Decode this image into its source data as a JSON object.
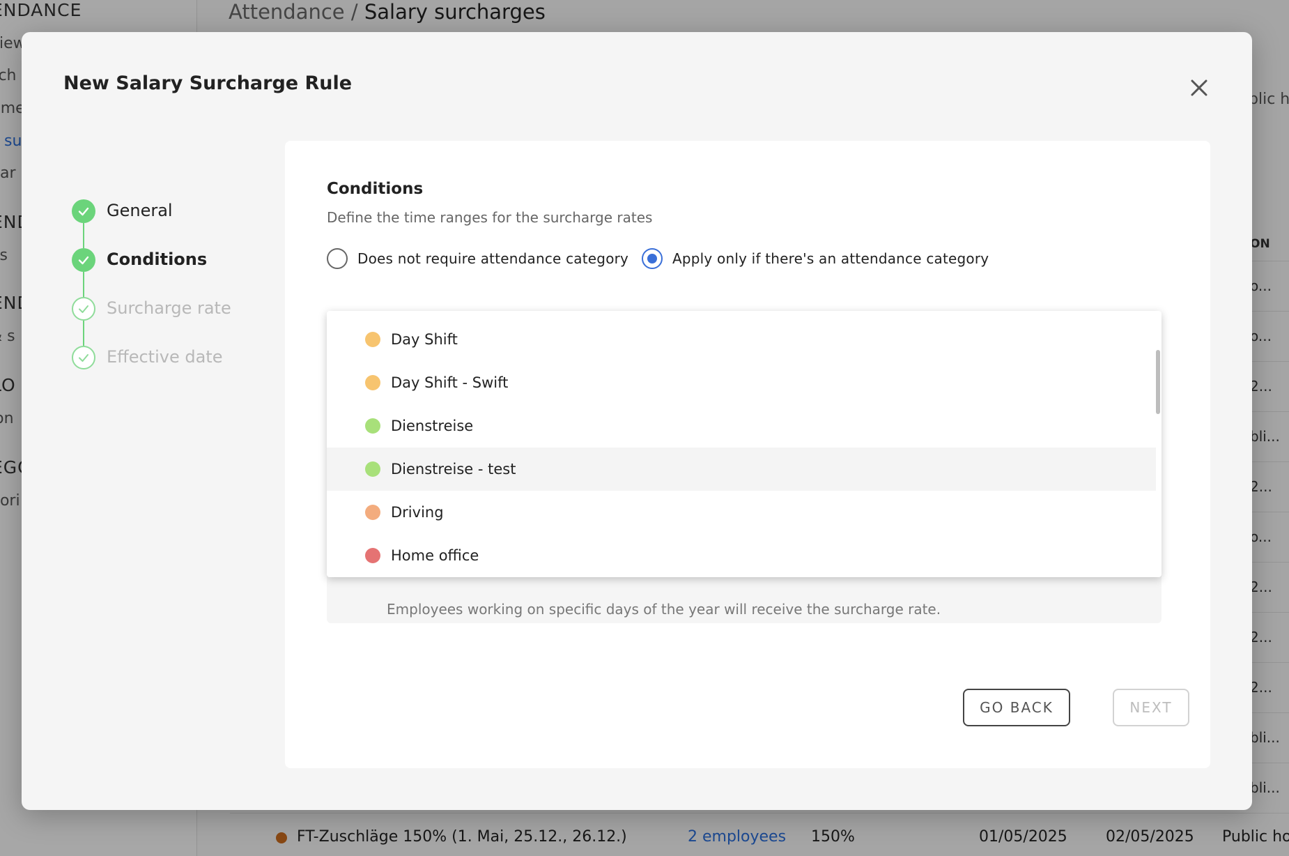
{
  "background": {
    "breadcrumb_parent": "Attendance /",
    "breadcrumb_current": "Salary surcharges",
    "sidebar_fragments": [
      {
        "text": "ENDANCE",
        "kind": "section"
      },
      {
        "text": "view",
        "kind": "item"
      },
      {
        "text": "sch",
        "kind": "item"
      },
      {
        "text": "time",
        "kind": "item"
      },
      {
        "text": "y su",
        "kind": "item",
        "active": true
      },
      {
        "text": "dar",
        "kind": "item"
      },
      {
        "text": "END",
        "kind": "section"
      },
      {
        "text": "es",
        "kind": "item"
      },
      {
        "text": "END",
        "kind": "section"
      },
      {
        "text": "& s",
        "kind": "item"
      },
      {
        "text": "LO",
        "kind": "section"
      },
      {
        "text": "ion",
        "kind": "item"
      },
      {
        "text": "EGO",
        "kind": "section"
      },
      {
        "text": "gori",
        "kind": "item"
      }
    ],
    "top_right_fragment": "blic ho",
    "column_header_fragment": "ON",
    "right_column_fragments": [
      "o...",
      "o...",
      "2...",
      "bli...",
      "2...",
      "o...",
      "2...",
      "2...",
      "2...",
      "bli...",
      "bli..."
    ],
    "last_row": {
      "name": "FT-Zuschläge 150% (1. Mai, 25.12., 26.12.)",
      "employees": "2 employees",
      "rate": "150%",
      "start": "01/05/2025",
      "end": "02/05/2025",
      "type": "Public holi..."
    }
  },
  "modal": {
    "title": "New Salary Surcharge Rule",
    "steps": [
      {
        "label": "General",
        "state": "done"
      },
      {
        "label": "Conditions",
        "state": "current"
      },
      {
        "label": "Surcharge rate",
        "state": "todo"
      },
      {
        "label": "Effective date",
        "state": "todo"
      }
    ],
    "section_title": "Conditions",
    "section_subtitle": "Define the time ranges for the surcharge rates",
    "radio_options": [
      {
        "label": "Does not require attendance category",
        "selected": false
      },
      {
        "label": "Apply only if there's an attendance category",
        "selected": true
      }
    ],
    "dropdown_options": [
      {
        "label": "Day Shift",
        "color": "#f7c46f"
      },
      {
        "label": "Day Shift - Swift",
        "color": "#f7c46f"
      },
      {
        "label": "Dienstreise",
        "color": "#a8e07a"
      },
      {
        "label": "Dienstreise - test",
        "color": "#a8e07a",
        "hovered": true
      },
      {
        "label": "Driving",
        "color": "#f3ac7e"
      },
      {
        "label": "Home office",
        "color": "#e57373"
      }
    ],
    "hidden_description": "Employees working on specific days of the year will receive the surcharge rate.",
    "go_back_label": "GO BACK",
    "next_label": "NEXT"
  }
}
